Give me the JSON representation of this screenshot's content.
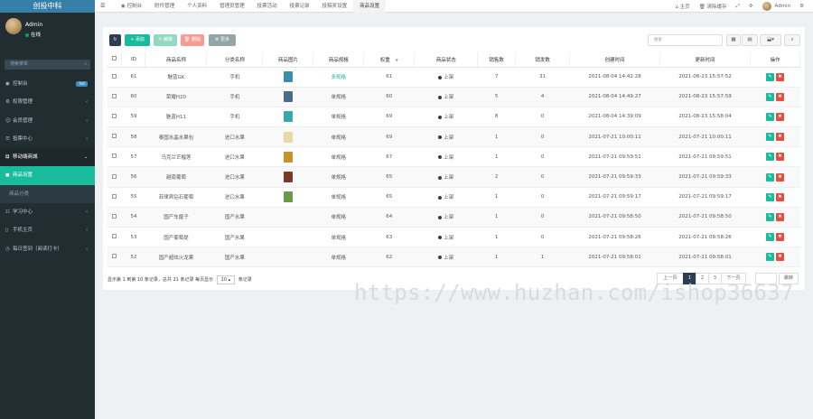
{
  "sidebar": {
    "logo": "创投中科",
    "user": {
      "name": "Admin",
      "status": "在线"
    },
    "search_placeholder": "搜索菜单",
    "items": [
      {
        "icon": "dashboard-icon",
        "glyph": "◉",
        "label": "控制台",
        "badge": "hot"
      },
      {
        "icon": "cogs-icon",
        "glyph": "⚙",
        "label": "权限管理",
        "arrow": "‹"
      },
      {
        "icon": "users-icon",
        "glyph": "☺",
        "label": "会员管理",
        "arrow": "‹"
      },
      {
        "icon": "vote-icon",
        "glyph": "☰",
        "label": "投票中心",
        "arrow": "‹"
      },
      {
        "icon": "cart-icon",
        "glyph": "⛾",
        "label": "移动端商城",
        "arrow": "⌄"
      },
      {
        "icon": "goods-icon",
        "glyph": "◼",
        "label": "商品设置"
      },
      {
        "icon": "category-icon",
        "glyph": "",
        "label": "商品分类"
      },
      {
        "icon": "study-icon",
        "glyph": "☷",
        "label": "学习中心",
        "arrow": "‹"
      },
      {
        "icon": "mobile-icon",
        "glyph": "▯",
        "label": "手机主页",
        "arrow": "‹"
      },
      {
        "icon": "checkin-icon",
        "glyph": "◷",
        "label": "每日签到（阅读打卡）",
        "arrow": "‹"
      }
    ]
  },
  "topbar": {
    "menu_glyph": "☰",
    "tabs": [
      "控制台",
      "附件管理",
      "个人资料",
      "管理员管理",
      "投票活动",
      "投票记录",
      "投稿奖设置",
      "商品设置"
    ],
    "right": {
      "home": "主页",
      "clear": "清除缓存",
      "user": "Admin"
    }
  },
  "toolbar": {
    "refresh": "↻",
    "add": "+ 添加",
    "edit": "✎ 编辑",
    "del": "🗑 删除",
    "more": "⚙ 更多",
    "search_placeholder": "搜索",
    "tools": [
      "▦",
      "▤",
      "⬓▾",
      "⌕"
    ]
  },
  "table": {
    "headers": [
      "ID",
      "商品名称",
      "分类名称",
      "商品图片",
      "商品规格",
      "权重",
      "商品状态",
      "销售数",
      "销发数",
      "创建时间",
      "更新时间",
      "操作"
    ],
    "rows": [
      {
        "id": "61",
        "name": "魅蓝GK",
        "cat": "手机",
        "img": "#3a8fa8",
        "spec": "多规格",
        "w": "61",
        "status": "上架",
        "sold": "7",
        "sent": "31",
        "created": "2021-08-04 14:42:28",
        "updated": "2021-08-23 15:57:52"
      },
      {
        "id": "60",
        "name": "荣耀H20",
        "cat": "手机",
        "img": "#4a6b8a",
        "spec": "单规格",
        "w": "60",
        "status": "上架",
        "sold": "5",
        "sent": "4",
        "created": "2021-08-04 14:49:27",
        "updated": "2021-08-23 15:57:59"
      },
      {
        "id": "59",
        "name": "魅蓝H11",
        "cat": "手机",
        "img": "#3aa6b0",
        "spec": "单规格",
        "w": "69",
        "status": "上架",
        "sold": "8",
        "sent": "0",
        "created": "2021-08-04 14:39:09",
        "updated": "2021-08-23 15:58:04"
      },
      {
        "id": "58",
        "name": "泰国水晶水果包",
        "cat": "进口水果",
        "img": "#e8d9a8",
        "spec": "单规格",
        "w": "69",
        "status": "上架",
        "sold": "1",
        "sent": "0",
        "created": "2021-07-21 10:00:11",
        "updated": "2021-07-21 10:00:11"
      },
      {
        "id": "57",
        "name": "乌克兰芒榴莲",
        "cat": "进口水果",
        "img": "#c99228",
        "spec": "单规格",
        "w": "67",
        "status": "上架",
        "sold": "1",
        "sent": "0",
        "created": "2021-07-21 09:59:51",
        "updated": "2021-07-21 09:59:51"
      },
      {
        "id": "56",
        "name": "越南葡萄",
        "cat": "进口水果",
        "img": "#7a3a2a",
        "spec": "单规格",
        "w": "65",
        "status": "上架",
        "sold": "2",
        "sent": "0",
        "created": "2021-07-21 09:59:33",
        "updated": "2021-07-21 09:59:33"
      },
      {
        "id": "55",
        "name": "菲律宾钻石葡萄",
        "cat": "进口水果",
        "img": "#6a9a48",
        "spec": "单规格",
        "w": "65",
        "status": "上架",
        "sold": "1",
        "sent": "0",
        "created": "2021-07-21 09:59:17",
        "updated": "2021-07-21 09:59:17"
      },
      {
        "id": "54",
        "name": "国产车厘子",
        "cat": "国产水果",
        "img": "",
        "spec": "单规格",
        "w": "64",
        "status": "上架",
        "sold": "1",
        "sent": "0",
        "created": "2021-07-21 09:58:50",
        "updated": "2021-07-21 09:58:50"
      },
      {
        "id": "53",
        "name": "国产葡萄提",
        "cat": "国产水果",
        "img": "",
        "spec": "单规格",
        "w": "63",
        "status": "上架",
        "sold": "1",
        "sent": "0",
        "created": "2021-07-21 09:58:26",
        "updated": "2021-07-21 09:58:26"
      },
      {
        "id": "52",
        "name": "国产超炫火龙果",
        "cat": "国产水果",
        "img": "",
        "spec": "单规格",
        "w": "62",
        "status": "上架",
        "sold": "1",
        "sent": "1",
        "created": "2021-07-21 09:58:01",
        "updated": "2021-07-21 09:58:01"
      }
    ]
  },
  "footer": {
    "info_prefix": "显示第 1 到第 10 条记录，总共 21 条记录 每页显示",
    "page_size": "10 ▴",
    "info_suffix": "条记录",
    "prev": "上一页",
    "pages": [
      "1",
      "2",
      "3"
    ],
    "next": "下一页",
    "jump": "跳转"
  },
  "watermark": "https://www.huzhan.com/ishop36637",
  "colors": {
    "sidebar": "#222d32",
    "accent": "#18bc9c",
    "danger": "#e74c3c",
    "dark": "#2c3e50"
  }
}
